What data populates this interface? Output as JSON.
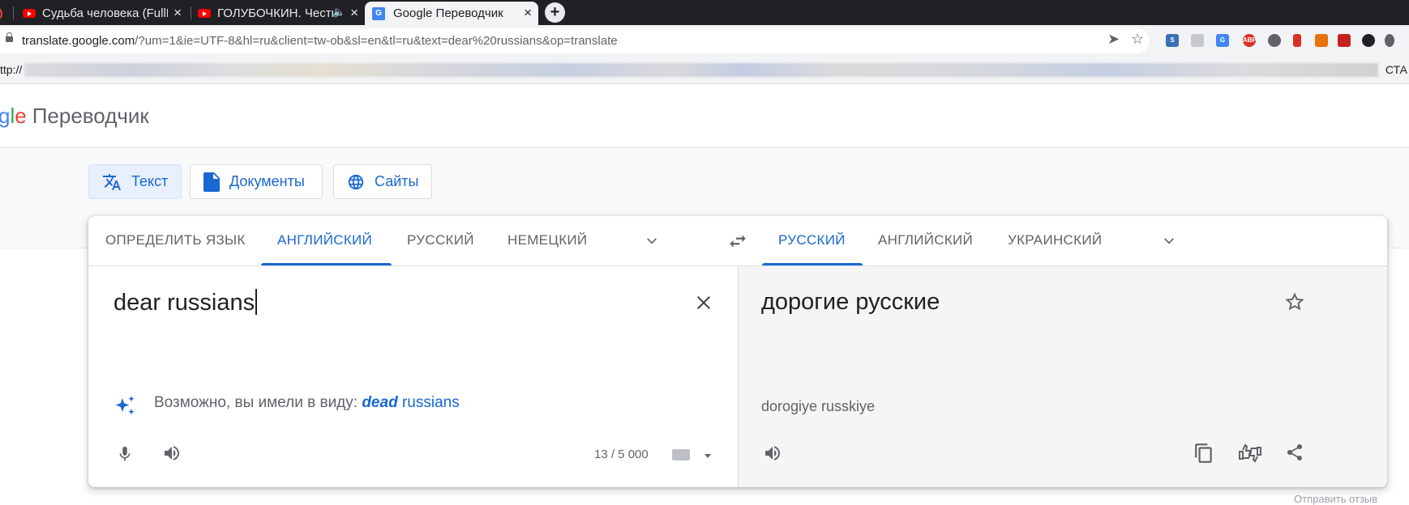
{
  "browser": {
    "tabs": [
      {
        "title": "Судьба человека (FullHD",
        "close": "×"
      },
      {
        "title": "ГОЛУБОЧКИН. Честно",
        "close": "×"
      },
      {
        "title": "Google Переводчик",
        "close": "×"
      }
    ],
    "new_tab_label": "+",
    "url_host": "translate.google.com",
    "url_path": "/?um=1&ie=UTF-8&hl=ru&client=tw-ob&sl=en&tl=ru&text=dear%20russians&op=translate",
    "bookmarks_left": "ttp://",
    "bookmarks_right": "СТА"
  },
  "header": {
    "logo_partial": "gle",
    "product": "Переводчик"
  },
  "modes": [
    {
      "label": "Текст",
      "icon": "translate-icon"
    },
    {
      "label": "Документы",
      "icon": "document-icon"
    },
    {
      "label": "Сайты",
      "icon": "globe-icon"
    }
  ],
  "source_langs": [
    "ОПРЕДЕЛИТЬ ЯЗЫК",
    "АНГЛИЙСКИЙ",
    "РУССКИЙ",
    "НЕМЕЦКИЙ"
  ],
  "target_langs": [
    "РУССКИЙ",
    "АНГЛИЙСКИЙ",
    "УКРАИНСКИЙ"
  ],
  "source": {
    "text": "dear russians",
    "suggestion_prefix": "Возможно, вы имели в виду:",
    "suggestion_bold": "dead",
    "suggestion_rest": " russians",
    "counter": "13 / 5 000"
  },
  "target": {
    "text": "дорогие русские",
    "transliteration": "dorogiye russkiye"
  },
  "footer": {
    "feedback": "Отправить отзыв"
  },
  "colors": {
    "accent": "#1967d2",
    "selected_mode_bg": "#e8f0fe",
    "target_bg": "#f5f5f5"
  }
}
